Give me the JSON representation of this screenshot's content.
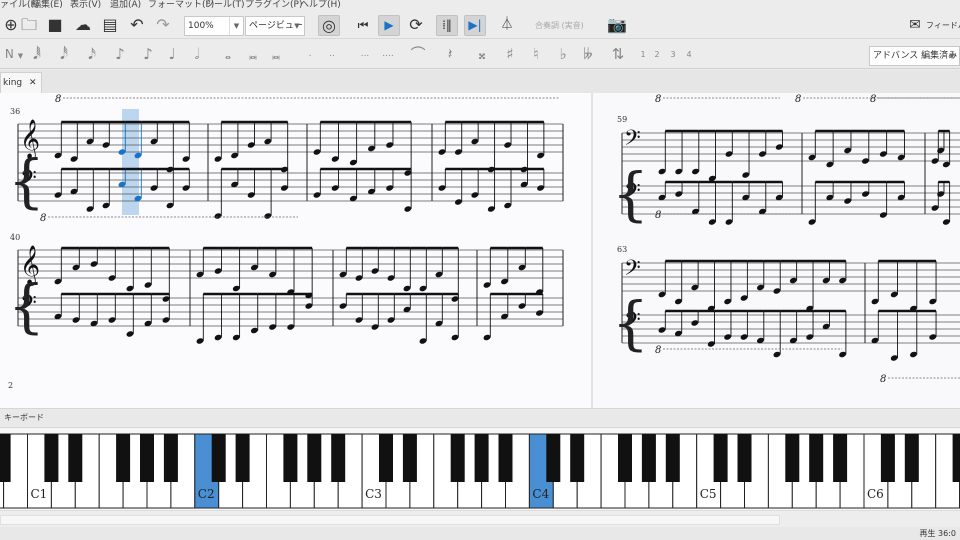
{
  "menu": [
    "ァイル(F)",
    "編集(E)",
    "表示(V)",
    "追加(A)",
    "フォーマット(F)",
    "ツール(T)",
    "プラグイン(P)",
    "ヘルプ(H)"
  ],
  "toolbar": {
    "zoom": "100%",
    "view_mode": "ページビュー",
    "concert_pitch": "合奏調 (実音)",
    "feedback": "フィードバ",
    "icons": [
      "new-file-icon",
      "open-icon",
      "save-icon",
      "cloud-upload-icon",
      "print-icon",
      "undo-icon",
      "redo-icon",
      "midi-input-icon",
      "rewind-icon",
      "play-icon",
      "loop-icon",
      "repeat-icon",
      "pan-icon",
      "metronome-icon",
      "camera-icon",
      "envelope-icon"
    ]
  },
  "note_input": {
    "mode": "N",
    "durations": [
      "𝅘𝅥𝅱",
      "𝅘𝅥𝅰",
      "𝅘𝅥𝅯",
      "♪",
      "♪",
      "♩",
      "𝅗𝅥",
      "𝅝",
      "𝅜",
      "𝅜"
    ],
    "dots": [
      ".",
      "..",
      "...",
      "...."
    ],
    "tie": "⌒",
    "rest": "𝄽",
    "accidentals": [
      "𝄪",
      "♯",
      "♮",
      "♭",
      "𝄫"
    ],
    "flip": "⇅",
    "voices": [
      "1",
      "2",
      "3",
      "4"
    ],
    "workspace": "アドバンス 編集済み"
  },
  "tab": {
    "title": "king",
    "close": "✕"
  },
  "score": {
    "page_number": "2",
    "measure_numbers": [
      "36",
      "40",
      "59",
      "63"
    ],
    "ottava": "8",
    "selection_color": "#bcd6ef",
    "selected_note_color": "#1a73c7"
  },
  "keyboard": {
    "title": "キーボード",
    "labels": [
      "C1",
      "C2",
      "C3",
      "C4",
      "C5",
      "C6"
    ],
    "highlighted": [
      "C2",
      "C4"
    ],
    "highlight_color": "#4a8fd4"
  },
  "status": {
    "text": "再生  36:0"
  }
}
